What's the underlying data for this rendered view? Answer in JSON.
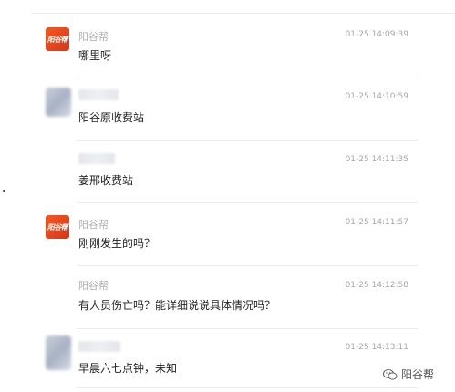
{
  "messages": [
    {
      "name": "阳谷帮",
      "time": "01-25 14:09:39",
      "text": "哪里呀",
      "avatar": "logo",
      "name_blurred": false
    },
    {
      "name": "",
      "time": "01-25 14:10:59",
      "text": "阳谷原收费站",
      "avatar": "blurred",
      "name_blurred": true
    },
    {
      "name": "",
      "time": "01-25 14:11:35",
      "text": "姜邢收费站",
      "avatar": "none",
      "name_blurred": true
    },
    {
      "name": "阳谷帮",
      "time": "01-25 14:11:57",
      "text": "刚刚发生的吗？",
      "avatar": "logo",
      "name_blurred": false
    },
    {
      "name": "阳谷帮",
      "time": "01-25 14:12:58",
      "text": "有人员伤亡吗？能详细说说具体情况吗？",
      "avatar": "none",
      "name_blurred": false
    },
    {
      "name": "",
      "time": "01-25 14:13:11",
      "text": "早晨六七点钟，未知",
      "avatar": "blurred",
      "name_blurred": true
    }
  ],
  "logo_text": "阳谷帮",
  "watermark": {
    "text": "阳谷帮",
    "icon": "wechat-icon"
  }
}
